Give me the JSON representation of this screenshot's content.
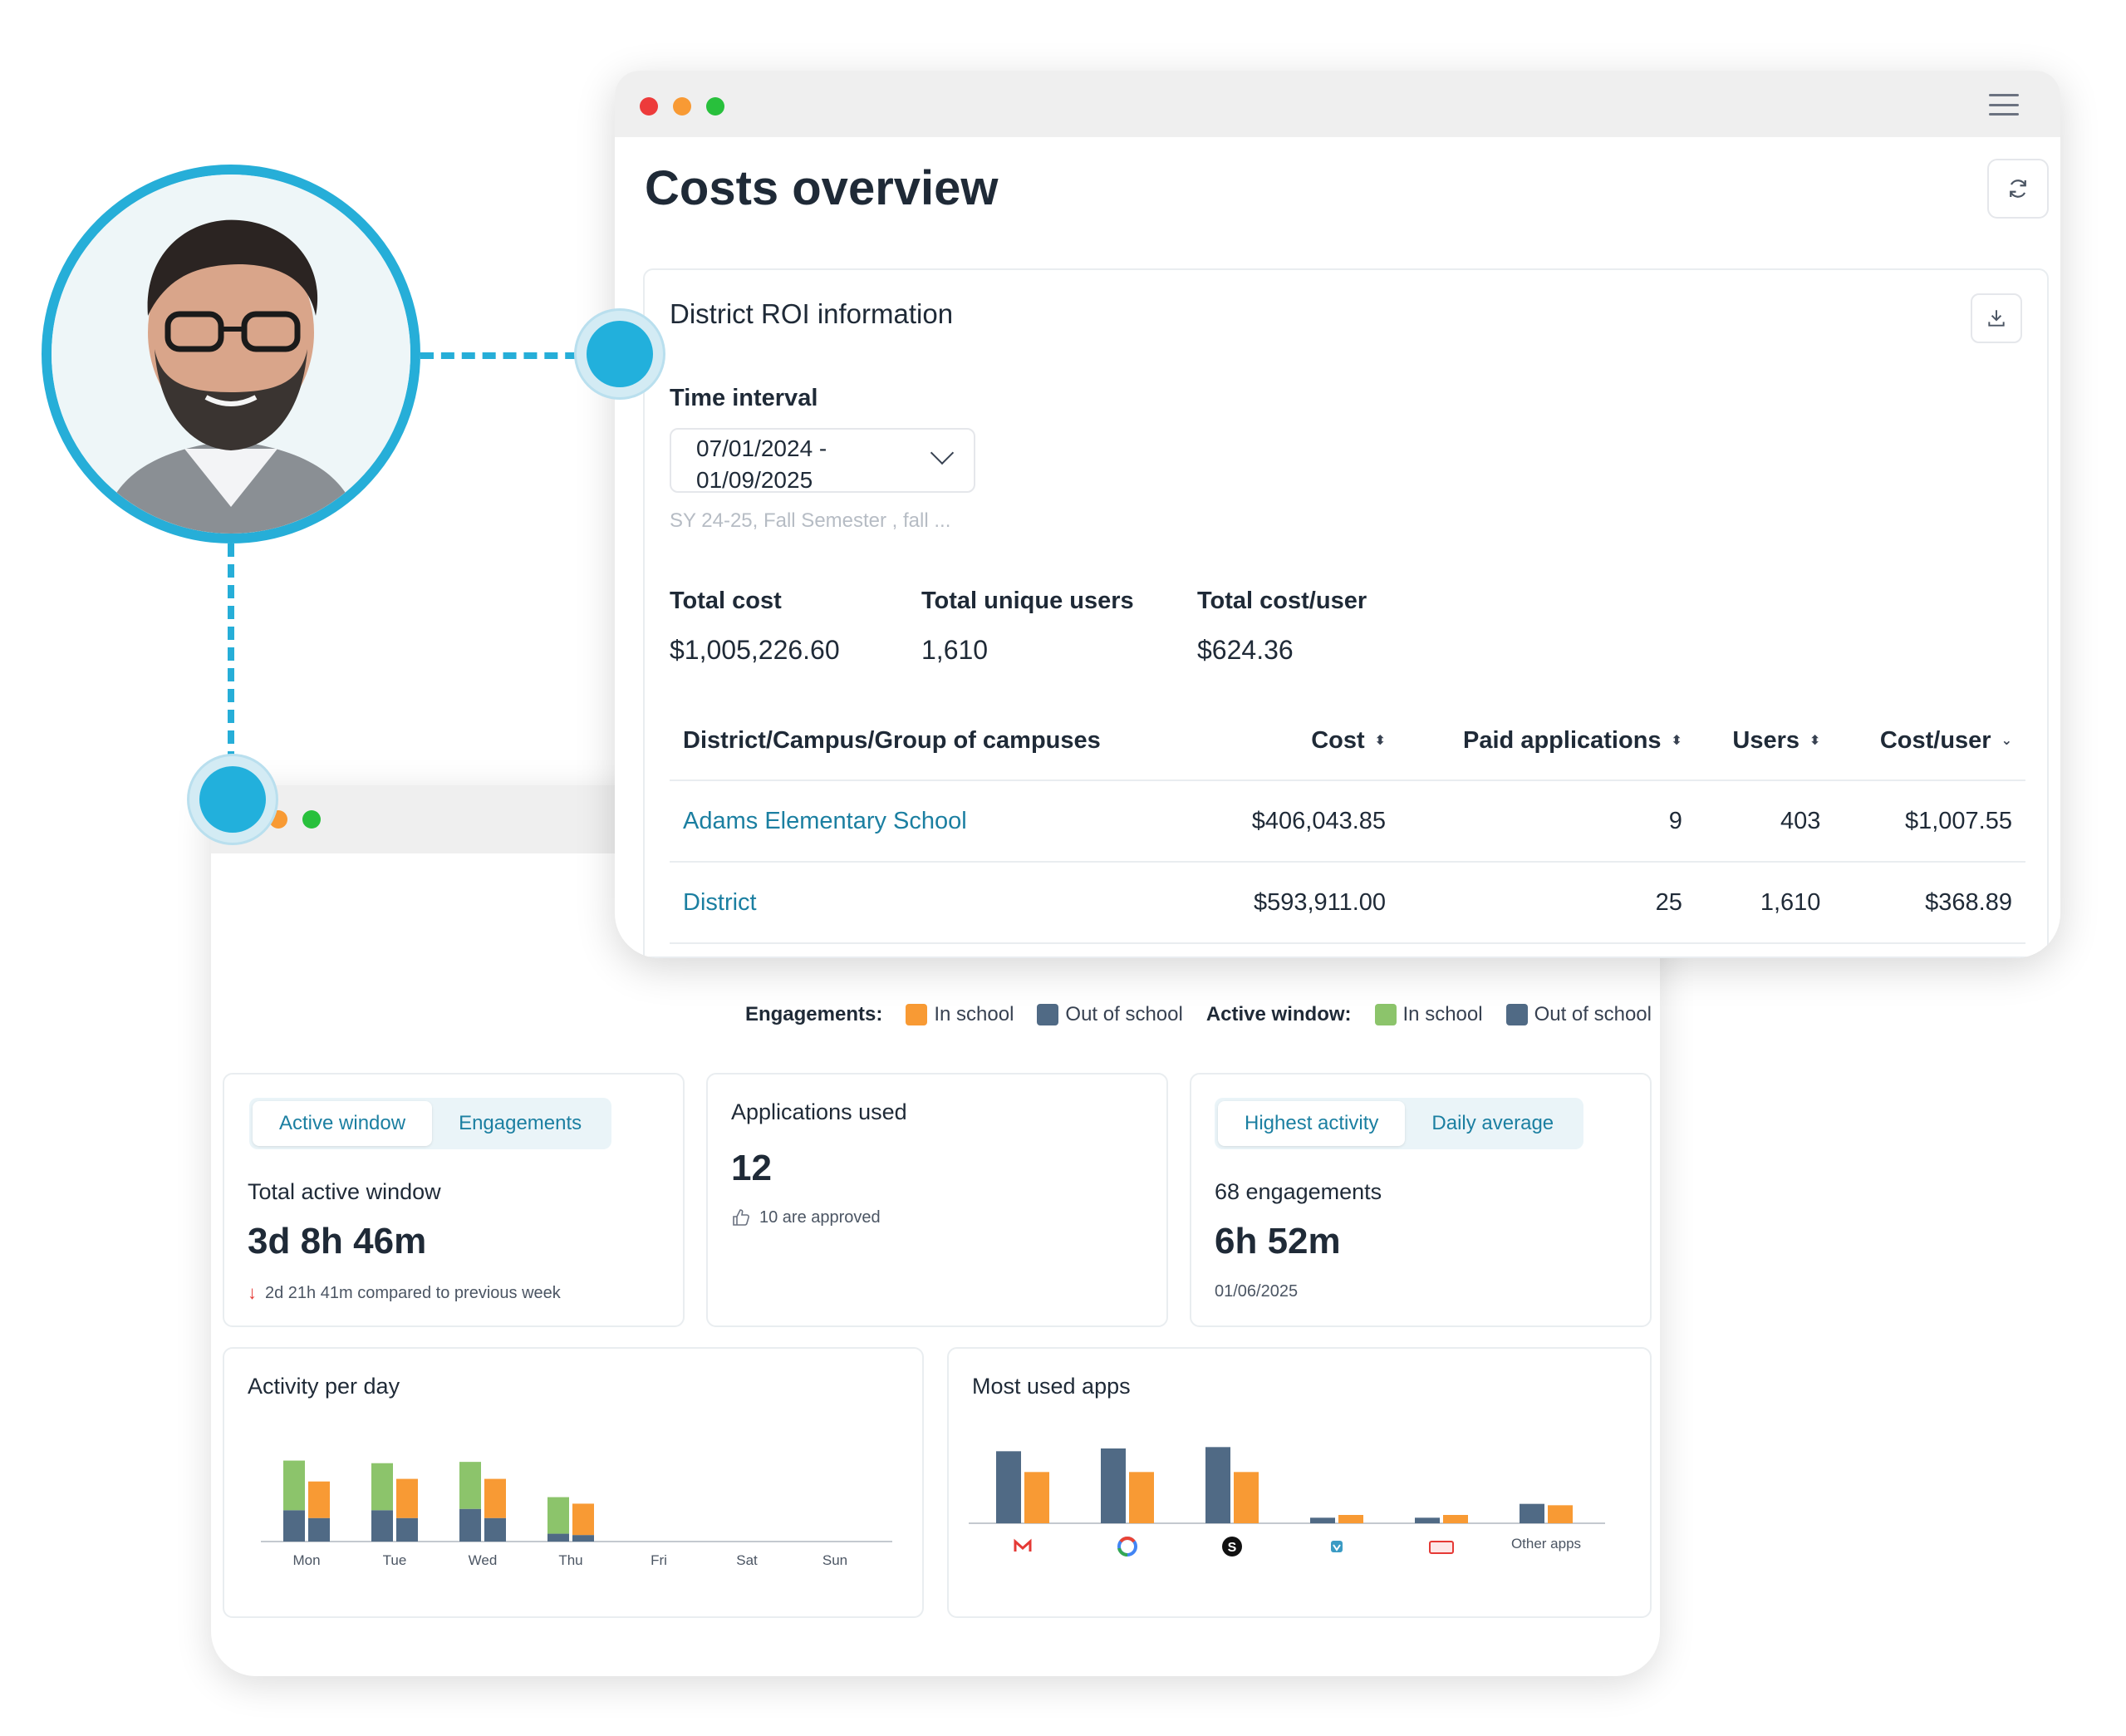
{
  "costs": {
    "title": "Costs overview",
    "roi_title": "District ROI information",
    "time_interval_label": "Time interval",
    "date_line1": "07/01/2024 -",
    "date_line2": "01/09/2025",
    "date_hint": "SY 24-25, Fall Semester , fall ...",
    "stats": [
      {
        "label": "Total cost",
        "value": "$1,005,226.60"
      },
      {
        "label": "Total unique users",
        "value": "1,610"
      },
      {
        "label": "Total cost/user",
        "value": "$624.36"
      }
    ],
    "table": {
      "headers": [
        "District/Campus/Group of campuses",
        "Cost",
        "Paid applications",
        "Users",
        "Cost/user"
      ],
      "rows": [
        [
          "Adams Elementary School",
          "$406,043.85",
          "9",
          "403",
          "$1,007.55"
        ],
        [
          "District",
          "$593,911.00",
          "25",
          "1,610",
          "$368.89"
        ]
      ]
    }
  },
  "legend": {
    "engagements_label": "Engagements:",
    "active_window_label": "Active window:",
    "in_school": "In school",
    "out_of_school": "Out of school"
  },
  "colors": {
    "accent": "#26aed8",
    "in_school_engagement": "#f89a34",
    "out_of_school": "#506a85",
    "in_school_active": "#8cc46b",
    "link": "#1b7fa1"
  },
  "active_card": {
    "tab_active": "Active window",
    "tab_engagements": "Engagements",
    "label": "Total active window",
    "value": "3d 8h 46m",
    "comparison": "2d 21h 41m compared to previous week"
  },
  "apps_card": {
    "label": "Applications used",
    "value": "12",
    "approved": "10 are approved"
  },
  "highest_card": {
    "tab_highest": "Highest activity",
    "tab_daily": "Daily average",
    "label": "68 engagements",
    "value": "6h 52m",
    "date": "01/06/2025"
  },
  "activity_chart": {
    "title": "Activity per day"
  },
  "apps_chart": {
    "title": "Most used apps"
  },
  "chart_data": [
    {
      "type": "bar",
      "title": "Activity per day",
      "categories": [
        "Mon",
        "Tue",
        "Wed",
        "Thu",
        "Fri",
        "Sat",
        "Sun"
      ],
      "series": [
        {
          "name": "In school",
          "values": [
            38,
            36,
            36,
            28,
            0,
            0,
            0
          ],
          "stack": "active",
          "color": "#8cc46b"
        },
        {
          "name": "Out of school",
          "values": [
            24,
            24,
            25,
            6,
            0,
            0,
            0
          ],
          "stack": "active",
          "color": "#506a85"
        },
        {
          "name": "In school",
          "values": [
            28,
            30,
            30,
            24,
            0,
            0,
            0
          ],
          "stack": "engagements",
          "color": "#f89a34"
        },
        {
          "name": "Out of school",
          "values": [
            18,
            18,
            18,
            5,
            0,
            0,
            0
          ],
          "stack": "engagements",
          "color": "#506a85"
        }
      ],
      "ylim": [
        0,
        70
      ],
      "grid": false
    },
    {
      "type": "bar",
      "title": "Most used apps",
      "categories": [
        "gmail-icon",
        "google-icon",
        "s-app-icon",
        "app-4-icon",
        "app-5-icon",
        "Other apps"
      ],
      "series": [
        {
          "name": "Out of school",
          "values": [
            52,
            54,
            55,
            4,
            4,
            14
          ],
          "color": "#506a85"
        },
        {
          "name": "In school",
          "values": [
            37,
            37,
            37,
            6,
            6,
            13
          ],
          "color": "#f89a34"
        }
      ],
      "ylim": [
        0,
        60
      ],
      "grid": false
    }
  ]
}
